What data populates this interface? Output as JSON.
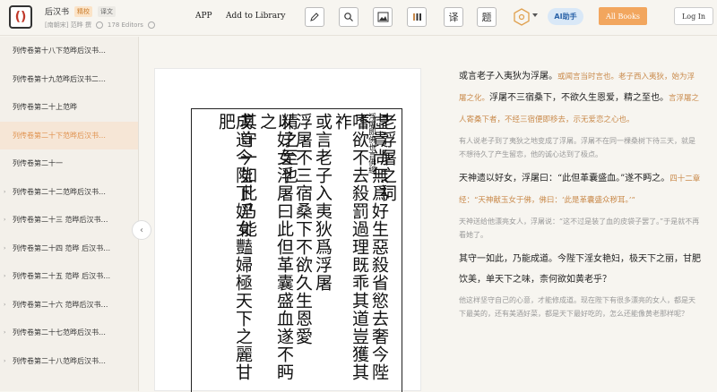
{
  "header": {
    "book_title": "后汉书",
    "badge_1": "精校",
    "badge_2": "译文",
    "meta_author": "[南朝宋] 范晔 撰",
    "meta_editors": "178 Editors",
    "app_link": "APP",
    "library_link": "Add to Library",
    "ai_label": "助手",
    "all_books": "All Books",
    "login": "Log In",
    "translate_tool": "译",
    "title_tool": "题"
  },
  "sidebar": {
    "items": [
      {
        "label": "列传卷第十八下范晔后汉书…",
        "arrow": false
      },
      {
        "label": "列传卷第十九范晔后汉书二…",
        "arrow": false
      },
      {
        "label": "列传卷第二十上范晔",
        "arrow": false
      },
      {
        "label": "列传卷第二十下范晔后汉书…",
        "arrow": false
      },
      {
        "label": "列传卷第二十一",
        "arrow": false
      },
      {
        "label": "列传卷第二十二范晔后汉书…",
        "arrow": true
      },
      {
        "label": "列传卷第二十三 范晔后汉书…",
        "arrow": true
      },
      {
        "label": "列传卷第二十四 范晔 后汉书…",
        "arrow": true
      },
      {
        "label": "列传卷第二十五 范晔 后汉书…",
        "arrow": true
      },
      {
        "label": "列传卷第二十六 范晔后汉书…",
        "arrow": true
      },
      {
        "label": "列传卷第二十七范晔后汉书…",
        "arrow": true
      },
      {
        "label": "列传卷第二十八范晔后汉书…",
        "arrow": true
      }
    ],
    "active_index": 3
  },
  "scan": {
    "columns": [
      {
        "text": "老浮屠之祠",
        "size": "big"
      },
      {
        "text": "浮屠即佛也言佛經",
        "size": "small"
      },
      {
        "text": "虛貴尚無爲好生惡殺省慾去奢今陛下",
        "size": "big"
      },
      {
        "text": "嗜欲不去殺罰過理既乖其道豈獲其祚",
        "size": "big"
      },
      {
        "text": "或言老子入夷狄爲浮屠",
        "size": "big"
      },
      {
        "text": "浮屠不三宿桑下不欲久生恩愛",
        "size": "big"
      },
      {
        "text": "精之至也",
        "size": "big"
      },
      {
        "text": "以好女浮屠曰此但革囊盛血遂不眄之",
        "size": "big"
      },
      {
        "text": "其守一如此乃能",
        "size": "big"
      },
      {
        "text": "成道今陛下婬女豔婦極天下之麗甘肥",
        "size": "big"
      }
    ]
  },
  "reader": {
    "p1_main": "或言老子入夷狄为浮屠。",
    "p1_gloss": "或闻言当时言也。老子西入夷狄，始为浮屠之化。",
    "p1_main2": "浮屠不三宿桑下，不欲久生恩爱，精之至也。",
    "p1_gloss2": "言浮屠之人寄桑下者，不经三宿便即移去，示无爱恋之心也。",
    "p1_trans": "有人说老子到了夷狄之地变成了浮屠。浮屠不在同一棵桑树下待三天，就是不想待久了产生留恋，他的诚心达到了极点。",
    "p2_main": "天神遗以好女，浮屠曰：“此但革囊盛血。”遂不眄之。",
    "p2_gloss": "四十二章经：“天神献玉女于佛，佛曰：‘此是革囊盛众秽耳。’”",
    "p2_trans": "天神送给他漂亮女人，浮屠说：“这不过是装了血的皮袋子罢了。”于是就不再看她了。",
    "p3_main": "其守一如此，乃能成道。今陛下淫女艳妇，极天下之丽，甘肥饮美，单天下之味，柰何欲如黄老乎？",
    "p3_trans": "他这样坚守自己的心意，才能修成道。现在陛下有很多漂亮的女人，都是天下最美的，还有美酒好菜，都是天下最好吃的，怎么还能像黄老那样呢？"
  },
  "colors": {
    "accent": "#f2a65e",
    "gloss": "#c98a4b",
    "active_item_bg": "#f6e6d6",
    "active_item_text": "#e0924f"
  }
}
